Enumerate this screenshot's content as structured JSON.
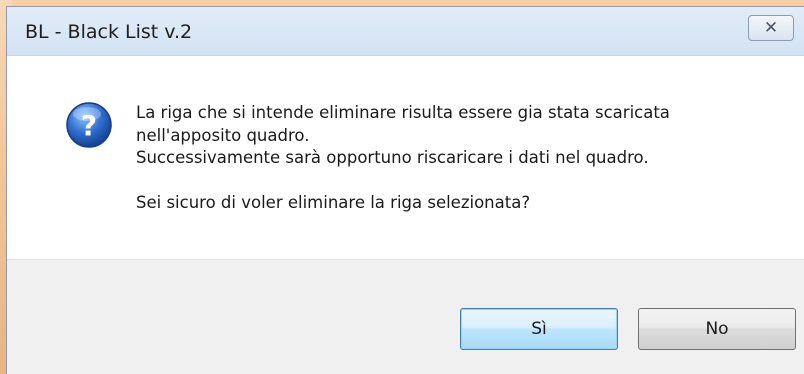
{
  "window": {
    "title": "BL - Black List v.2",
    "close_glyph": "✕"
  },
  "message": {
    "icon": "question-icon",
    "lines": [
      "La riga che si intende eliminare risulta essere gia stata scaricata",
      "nell'apposito quadro.",
      "Successivamente sarà opportuno riscaricare i dati nel quadro."
    ],
    "question": "Sei sicuro di voler eliminare la riga selezionata?"
  },
  "buttons": {
    "yes_label": "Sì",
    "no_label": "No"
  },
  "colors": {
    "icon_blue": "#2b5fb8",
    "title_bar": "#d8e6f5",
    "footer": "#f0f0f0"
  }
}
